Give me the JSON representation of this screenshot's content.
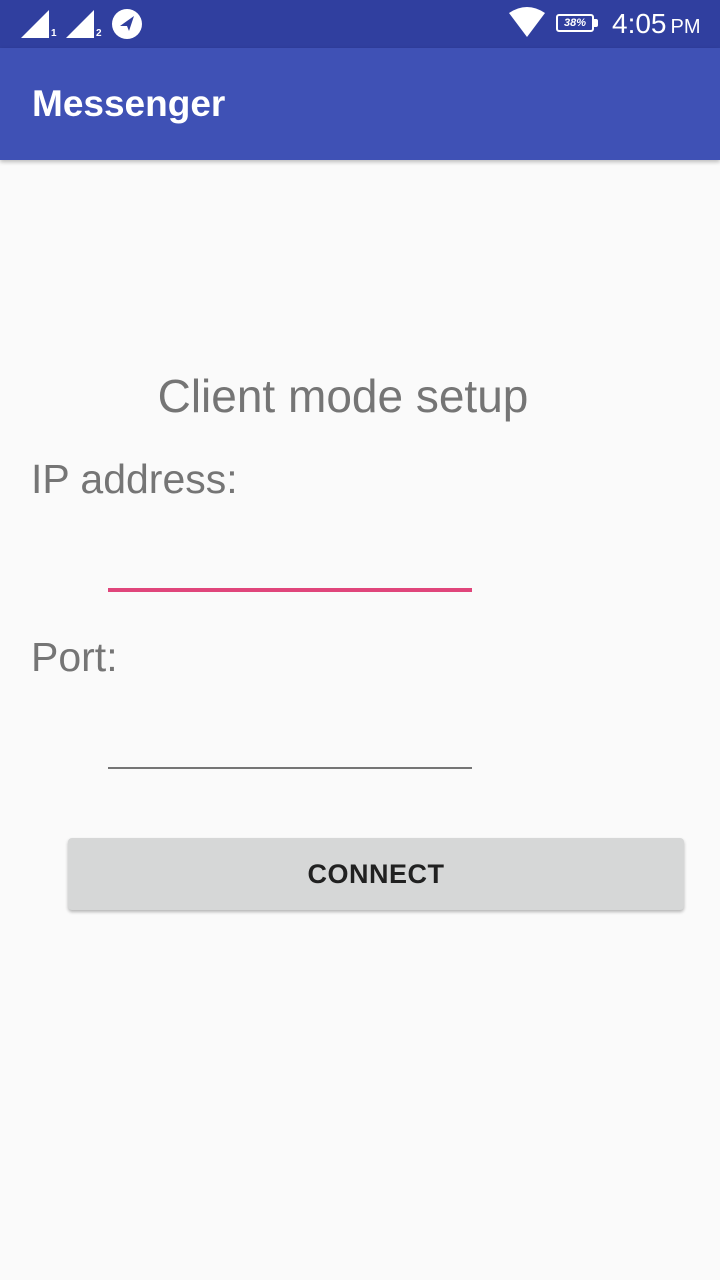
{
  "status_bar": {
    "icons": [
      "signal-1-icon",
      "signal-2-icon",
      "location-arrow-icon",
      "wifi-icon",
      "battery-icon"
    ],
    "sim1": "1",
    "sim2": "2",
    "battery_percent": "38%",
    "time": "4:05",
    "ampm": "PM",
    "background": "#303f9f"
  },
  "app_bar": {
    "title": "Messenger",
    "background": "#3f51b5"
  },
  "form": {
    "heading": "Client mode setup",
    "ip_label": "IP address:",
    "ip_value": "",
    "port_label": "Port:",
    "port_value": "",
    "focus_color": "#e0457b",
    "connect_label": "CONNECT"
  }
}
